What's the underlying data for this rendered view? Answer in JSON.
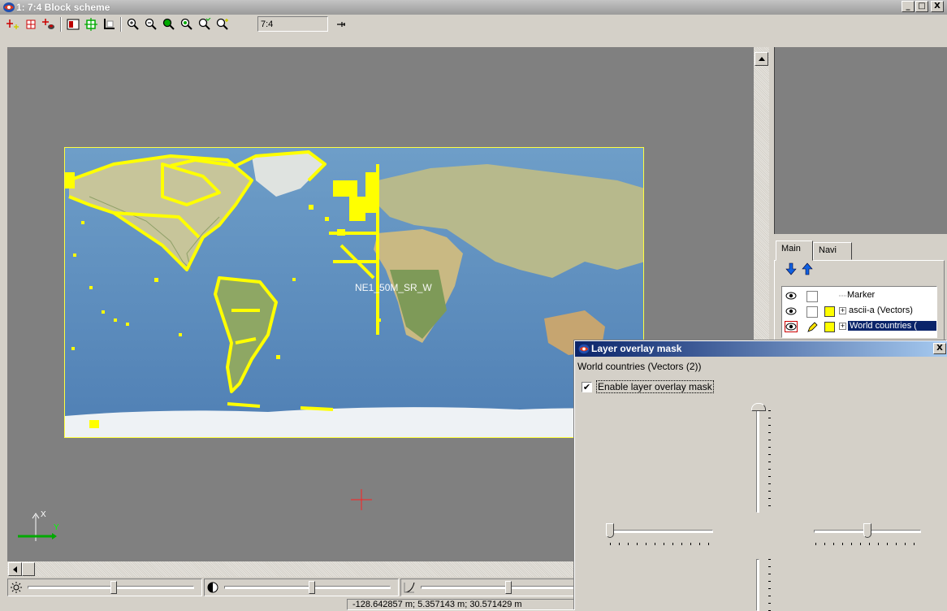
{
  "window": {
    "title": "1: 7:4 Block scheme",
    "minimize": "_",
    "maximize": "□",
    "close": "X"
  },
  "toolbar": {
    "scale_value": "7:4",
    "icons": [
      "add-marker-icon",
      "grid-icon",
      "add-layer-icon",
      "frame-icon",
      "crop-icon",
      "extent-icon",
      "zoom-in-icon",
      "zoom-out-icon",
      "zoom-region-icon",
      "zoom-100-icon",
      "zoom-fit-icon",
      "pin-icon"
    ]
  },
  "canvas": {
    "image_label": "NE1_50M_SR_W",
    "axis_x": "X",
    "axis_y": "Y",
    "highlight_color": "#ffff00"
  },
  "layers": {
    "tabs": [
      "Main",
      "Navi"
    ],
    "active_tab": "Main",
    "items": [
      {
        "name": "Marker",
        "color": null
      },
      {
        "name": "ascii-a (Vectors)",
        "color": "#ffff00"
      },
      {
        "name": "World countries (",
        "color": "#ffff00",
        "selected": true
      }
    ]
  },
  "dialog": {
    "title": "Layer overlay mask",
    "close": "X",
    "layer_name": "World countries (Vectors (2))",
    "enable_label": "Enable layer overlay mask",
    "enable_checked": true,
    "check_mark": "✔"
  },
  "status": {
    "coords": "-128.642857 m; 5.357143 m; 30.571429 m"
  }
}
